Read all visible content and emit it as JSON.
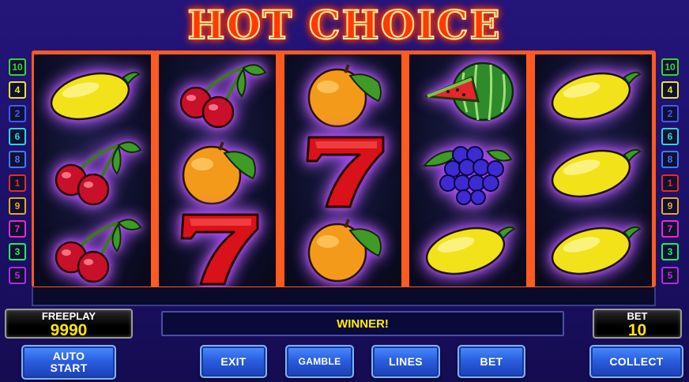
{
  "title": "HOT CHOICE",
  "reels": [
    [
      "lemon",
      "cherry",
      "cherry"
    ],
    [
      "cherry",
      "orange",
      "seven"
    ],
    [
      "orange",
      "seven",
      "orange"
    ],
    [
      "watermelon",
      "grapes",
      "lemon"
    ],
    [
      "lemon",
      "lemon",
      "lemon"
    ]
  ],
  "paylines_left": [
    {
      "label": "10",
      "color": "#3bd13b"
    },
    {
      "label": "4",
      "color": "#e6e62a"
    },
    {
      "label": "2",
      "color": "#3b5bff"
    },
    {
      "label": "6",
      "color": "#2ad4e6"
    },
    {
      "label": "8",
      "color": "#3b7bff"
    },
    {
      "label": "1",
      "color": "#e62a2a"
    },
    {
      "label": "9",
      "color": "#e6a82a"
    },
    {
      "label": "7",
      "color": "#e62ad4"
    },
    {
      "label": "3",
      "color": "#2ae66a"
    },
    {
      "label": "5",
      "color": "#b02ae6"
    }
  ],
  "paylines_right": [
    {
      "label": "10",
      "color": "#3bd13b"
    },
    {
      "label": "4",
      "color": "#e6e62a"
    },
    {
      "label": "2",
      "color": "#3b5bff"
    },
    {
      "label": "6",
      "color": "#2ad4e6"
    },
    {
      "label": "8",
      "color": "#3b7bff"
    },
    {
      "label": "1",
      "color": "#e62a2a"
    },
    {
      "label": "9",
      "color": "#e6a82a"
    },
    {
      "label": "7",
      "color": "#e62ad4"
    },
    {
      "label": "3",
      "color": "#2ae66a"
    },
    {
      "label": "5",
      "color": "#b02ae6"
    }
  ],
  "credit": {
    "label": "FREEPLAY",
    "value": "9990"
  },
  "bet": {
    "label": "BET",
    "value": "10"
  },
  "message": "WINNER!",
  "buttons": {
    "auto_start_line1": "AUTO",
    "auto_start_line2": "START",
    "exit": "EXIT",
    "gamble": "GAMBLE",
    "lines": "LINES",
    "bet": "BET",
    "collect": "COLLECT"
  }
}
